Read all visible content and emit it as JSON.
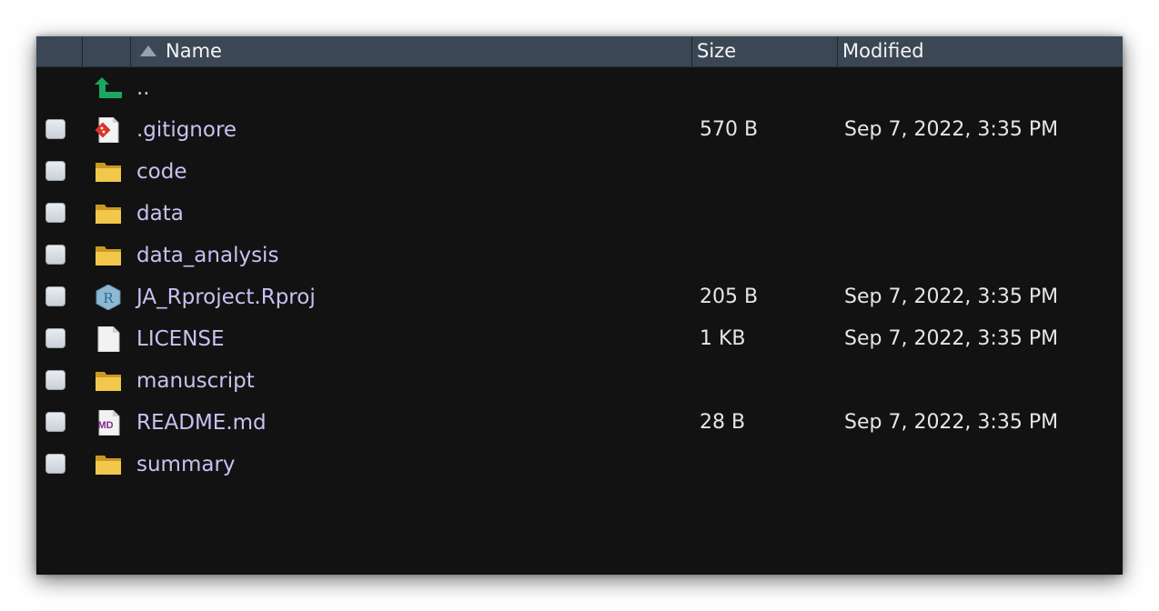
{
  "header": {
    "name": "Name",
    "size": "Size",
    "modified": "Modified"
  },
  "rows": [
    {
      "name": "..",
      "icon": "up-arrow-icon",
      "size": "",
      "modified": "",
      "checkbox": false
    },
    {
      "name": ".gitignore",
      "icon": "git-file-icon",
      "size": "570 B",
      "modified": "Sep 7, 2022, 3:35 PM",
      "checkbox": true
    },
    {
      "name": "code",
      "icon": "folder-icon",
      "size": "",
      "modified": "",
      "checkbox": true
    },
    {
      "name": "data",
      "icon": "folder-icon",
      "size": "",
      "modified": "",
      "checkbox": true
    },
    {
      "name": "data_analysis",
      "icon": "folder-icon",
      "size": "",
      "modified": "",
      "checkbox": true
    },
    {
      "name": "JA_Rproject.Rproj",
      "icon": "rproj-icon",
      "size": "205 B",
      "modified": "Sep 7, 2022, 3:35 PM",
      "checkbox": true
    },
    {
      "name": "LICENSE",
      "icon": "file-icon",
      "size": "1 KB",
      "modified": "Sep 7, 2022, 3:35 PM",
      "checkbox": true
    },
    {
      "name": "manuscript",
      "icon": "folder-icon",
      "size": "",
      "modified": "",
      "checkbox": true
    },
    {
      "name": "README.md",
      "icon": "markdown-file-icon",
      "size": "28 B",
      "modified": "Sep 7, 2022, 3:35 PM",
      "checkbox": true
    },
    {
      "name": "summary",
      "icon": "folder-icon",
      "size": "",
      "modified": "",
      "checkbox": true
    }
  ],
  "icon_labels": {
    "rproj": "R",
    "markdown": "MD"
  },
  "colors": {
    "header_bg": "#3b4754",
    "panel_bg": "#121212",
    "link_text": "#c7c2f0",
    "folder": "#e8b93a",
    "up_arrow": "#1aa860"
  }
}
